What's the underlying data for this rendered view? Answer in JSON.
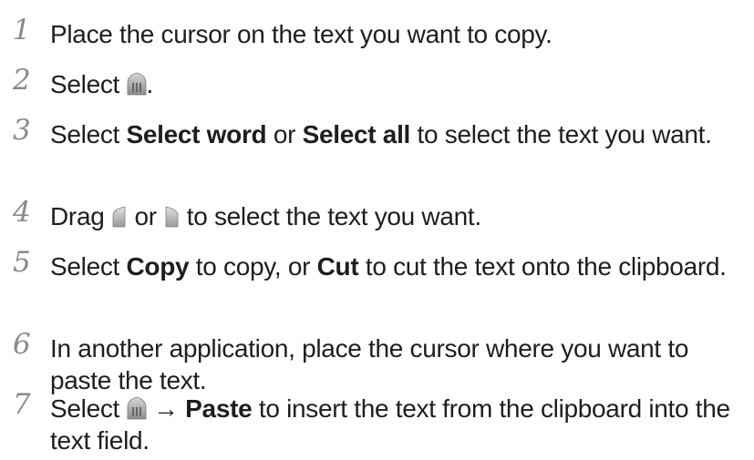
{
  "steps": [
    {
      "number": "1",
      "text": "Place the cursor on the text you want to copy."
    },
    {
      "number": "2",
      "prefix": "Select ",
      "icon": "clip-menu-icon",
      "suffix": "."
    },
    {
      "number": "3",
      "t1": "Select ",
      "b1": "Select word",
      "t2": " or ",
      "b2": "Select all",
      "t3": " to select the text you want."
    },
    {
      "number": "4",
      "t1": "Drag ",
      "icon1": "left-selection-handle-icon",
      "t2": " or ",
      "icon2": "right-selection-handle-icon",
      "t3": " to select the text you want."
    },
    {
      "number": "5",
      "t1": "Select ",
      "b1": "Copy",
      "t2": " to copy, or ",
      "b2": "Cut",
      "t3": " to cut the text onto the clipboard."
    },
    {
      "number": "6",
      "text": "In another application, place the cursor where you want to paste the text."
    },
    {
      "number": "7",
      "t1": "Select ",
      "icon": "clip-menu-icon",
      "arrow": " → ",
      "b1": "Paste",
      "t2": " to insert the text from the clipboard into the text field."
    }
  ]
}
